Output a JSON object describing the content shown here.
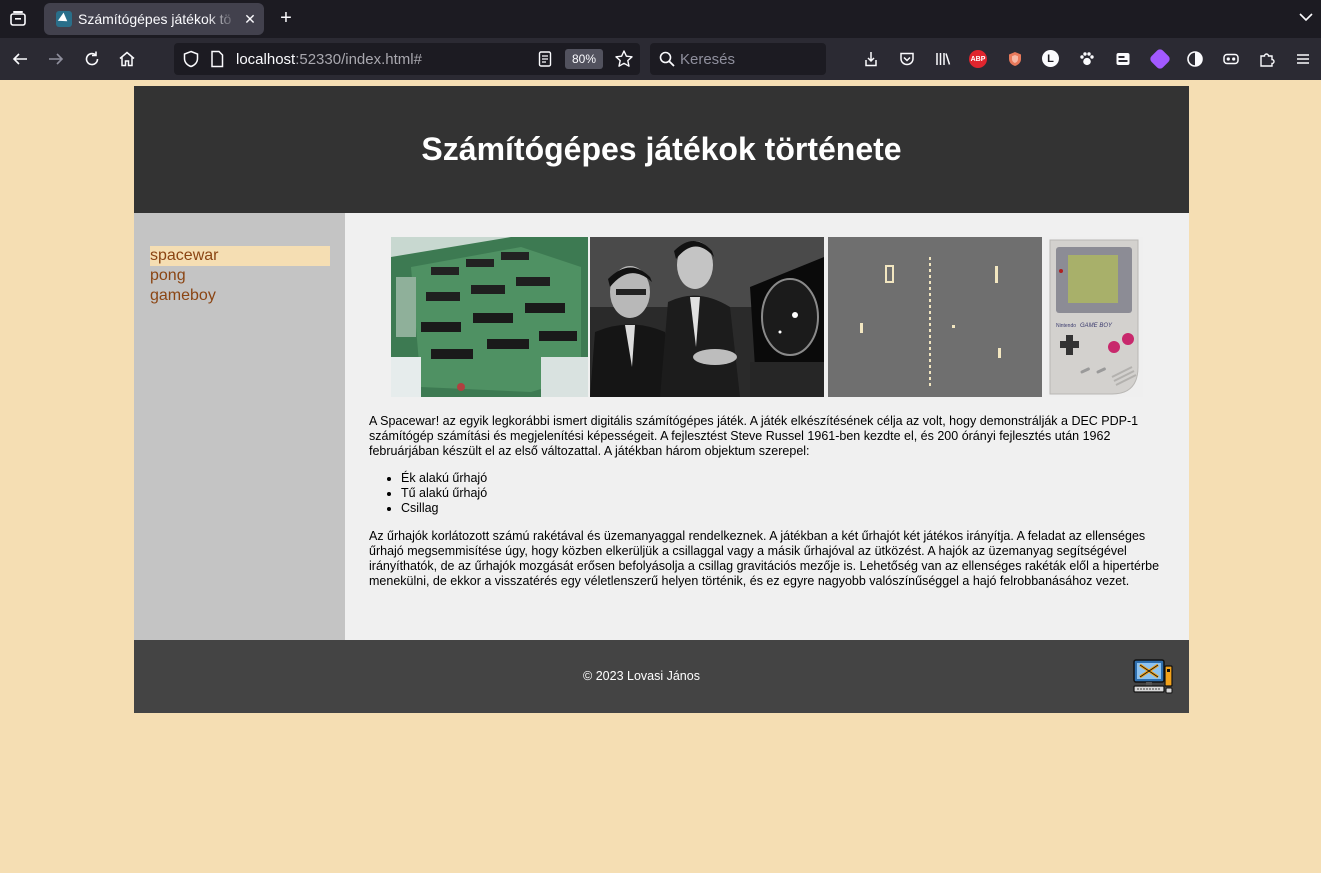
{
  "browser": {
    "tab_title": "Számítógépes játékok tö",
    "url_host": "localhost",
    "url_rest": ":52330/index.html#",
    "zoom": "80%",
    "search_placeholder": "Keresés"
  },
  "site": {
    "title": "Számítógépes játékok története",
    "menu": [
      {
        "label": "spacewar",
        "active": true
      },
      {
        "label": "pong",
        "active": false
      },
      {
        "label": "gameboy",
        "active": false
      }
    ],
    "intro": "A Spacewar! az egyik legkorábbi ismert digitális számítógépes játék. A játék elkészítésének célja az volt, hogy demonstrálják a DEC PDP-1 számítógép számítási és megjelenítési képességeit. A fejlesztést Steve Russel 1961-ben kezdte el, és 200 órányi fejlesztés után 1962 februárjában készült el az első változattal. A játékban három objektum szerepel:",
    "objects": [
      "Ék alakú űrhajó",
      "Tű alakú űrhajó",
      "Csillag"
    ],
    "details": "Az űrhajók korlátozott számú rakétával és üzemanyaggal rendelkeznek. A játékban a két űrhajót két játékos irányítja. A feladat az ellenséges űrhajó megsemmisítése úgy, hogy közben elkerüljük a csillaggal vagy a másik űrhajóval az ütközést. A hajók az üzemanyag segítségével irányíthatók, de az űrhajók mozgását erősen befolyásolja a csillag gravitációs mezője is. Lehetőség van az ellenséges rakéták elől a hipertérbe menekülni, de ekkor a visszatérés egy véletlenszerű helyen történik, és ez egyre nagyobb valószínűséggel a hajó felrobbanásához vezet.",
    "footer": "© 2023 Lovasi János",
    "gameboy_brand": "Nintendo",
    "gameboy_label": "GAME BOY"
  }
}
